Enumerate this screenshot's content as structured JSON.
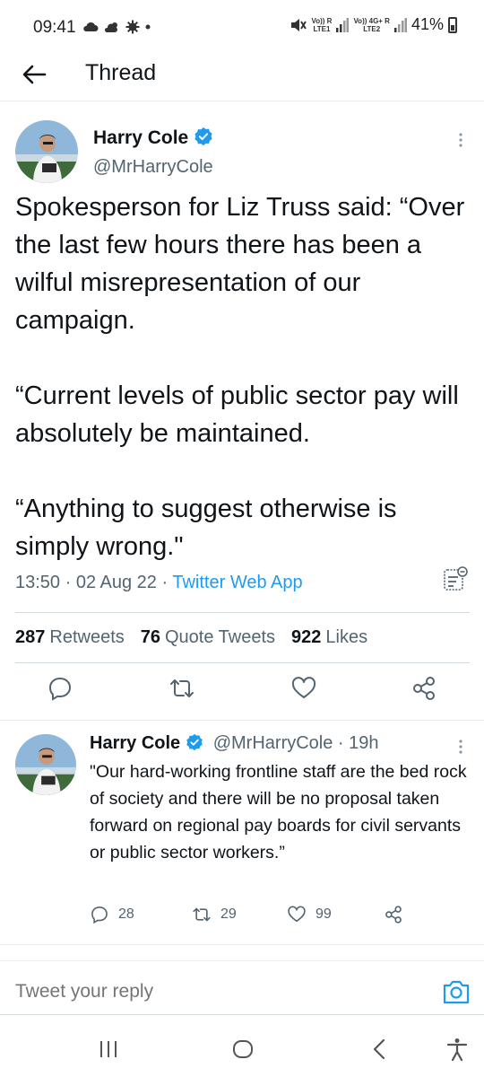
{
  "status_bar": {
    "time": "09:41",
    "sim1_label": "Vo)) R\nLTE1",
    "sim2_label": "Vo)) 4G+ R\nLTE2",
    "battery": "41%"
  },
  "header": {
    "title": "Thread"
  },
  "tweet": {
    "author_name": "Harry Cole",
    "author_handle": "@MrHarryCole",
    "text": "Spokesperson for Liz Truss said: “Over the last few hours there has been a wilful misrepresentation of our campaign.\n\n“Current levels of public sector pay will absolutely be maintained.\n\n“Anything to suggest otherwise is simply wrong.\"",
    "time": "13:50",
    "date": "02 Aug 22",
    "source": "Twitter Web App",
    "retweets_count": "287",
    "retweets_label": "Retweets",
    "quotes_count": "76",
    "quotes_label": "Quote Tweets",
    "likes_count": "922",
    "likes_label": "Likes"
  },
  "reply": {
    "author_name": "Harry Cole",
    "author_handle": "@MrHarryCole",
    "age": "19h",
    "text": "\"Our hard-working frontline staff are the bed rock of society and there will be no proposal taken forward on regional pay boards for civil servants or public sector workers.”",
    "replies": "28",
    "retweets": "29",
    "likes": "99"
  },
  "compose": {
    "placeholder": "Tweet your reply"
  },
  "colors": {
    "accent": "#1d9bf0",
    "secondary_text": "#536471",
    "primary_text": "#0f1419"
  },
  "icons": [
    "back-arrow-icon",
    "verified-badge-icon",
    "more-vertical-icon",
    "reply-icon",
    "retweet-icon",
    "like-icon",
    "share-icon",
    "camera-icon",
    "tweet-analytics-icon"
  ]
}
